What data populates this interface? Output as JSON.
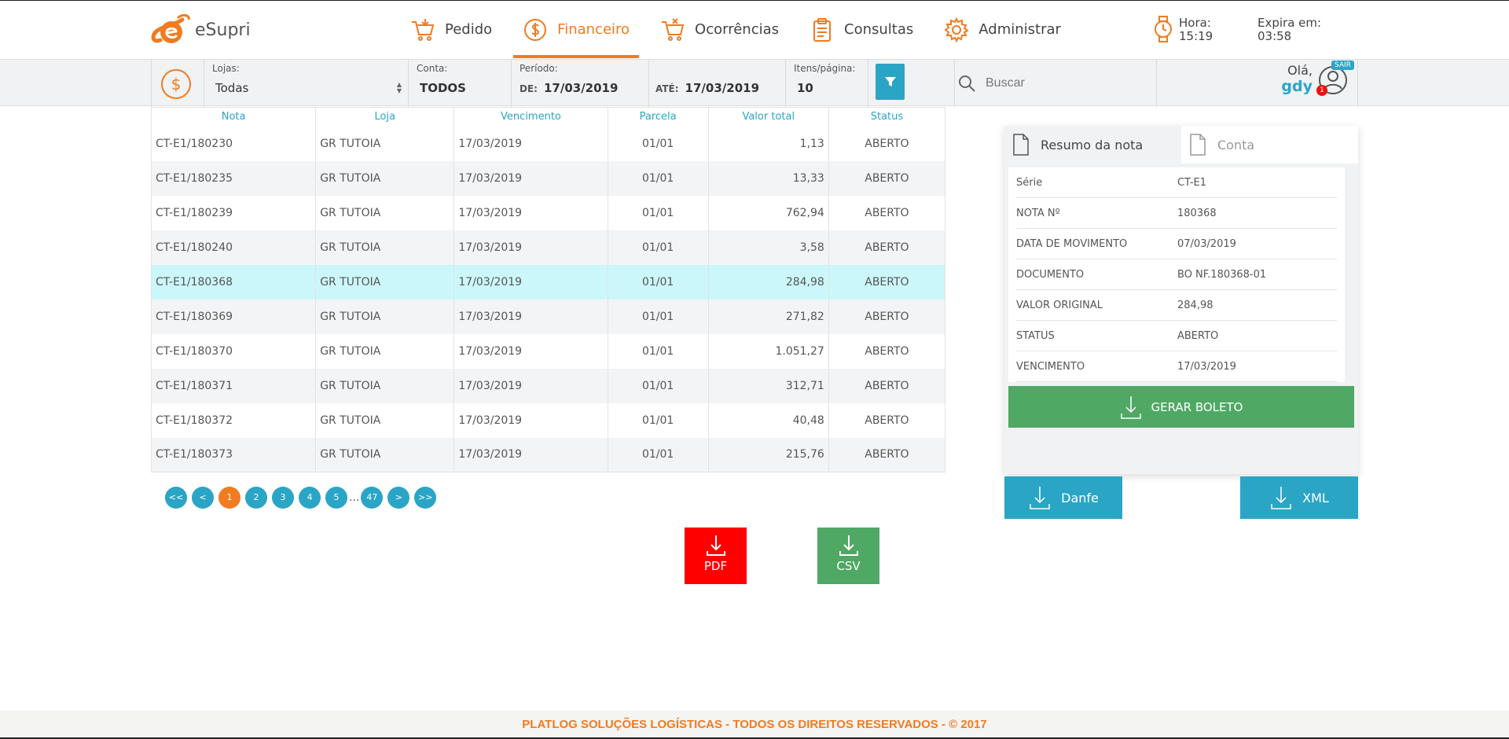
{
  "brand": {
    "name": "eSupri",
    "accent": "#f07b20",
    "secondary": "#2aa5c6"
  },
  "nav": [
    {
      "label": "Pedido",
      "icon": "cart-icon",
      "active": false
    },
    {
      "label": "Financeiro",
      "icon": "dollar-icon",
      "active": true
    },
    {
      "label": "Ocorrências",
      "icon": "cart-x-icon",
      "active": false
    },
    {
      "label": "Consultas",
      "icon": "clipboard-icon",
      "active": false
    },
    {
      "label": "Administrar",
      "icon": "gear-icon",
      "active": false
    }
  ],
  "session": {
    "hora_label": "Hora:",
    "hora_value": "15:19",
    "expira_label": "Expira em:",
    "expira_value": "03:58"
  },
  "filters": {
    "lojas_label": "Lojas:",
    "lojas_value": "Todas",
    "conta_label": "Conta:",
    "conta_value": "TODOS",
    "periodo_label": "Período:",
    "de_label": "DE:",
    "de_value": "17/03/2019",
    "ate_label": "ATÉ:",
    "ate_value": "17/03/2019",
    "itens_label": "Itens/página:",
    "itens_value": "10",
    "search_placeholder": "Buscar"
  },
  "user": {
    "greeting": "Olá,",
    "name": "gdy",
    "logout_label": "SAIR",
    "notifications": "1"
  },
  "table": {
    "headers": [
      "Nota",
      "Loja",
      "Vencimento",
      "Parcela",
      "Valor total",
      "Status"
    ],
    "rows": [
      [
        "CT-E1/180230",
        "GR TUTOIA",
        "17/03/2019",
        "01/01",
        "1,13",
        "ABERTO"
      ],
      [
        "CT-E1/180235",
        "GR TUTOIA",
        "17/03/2019",
        "01/01",
        "13,33",
        "ABERTO"
      ],
      [
        "CT-E1/180239",
        "GR TUTOIA",
        "17/03/2019",
        "01/01",
        "762,94",
        "ABERTO"
      ],
      [
        "CT-E1/180240",
        "GR TUTOIA",
        "17/03/2019",
        "01/01",
        "3,58",
        "ABERTO"
      ],
      [
        "CT-E1/180368",
        "GR TUTOIA",
        "17/03/2019",
        "01/01",
        "284,98",
        "ABERTO"
      ],
      [
        "CT-E1/180369",
        "GR TUTOIA",
        "17/03/2019",
        "01/01",
        "271,82",
        "ABERTO"
      ],
      [
        "CT-E1/180370",
        "GR TUTOIA",
        "17/03/2019",
        "01/01",
        "1.051,27",
        "ABERTO"
      ],
      [
        "CT-E1/180371",
        "GR TUTOIA",
        "17/03/2019",
        "01/01",
        "312,71",
        "ABERTO"
      ],
      [
        "CT-E1/180372",
        "GR TUTOIA",
        "17/03/2019",
        "01/01",
        "40,48",
        "ABERTO"
      ],
      [
        "CT-E1/180373",
        "GR TUTOIA",
        "17/03/2019",
        "01/01",
        "215,76",
        "ABERTO"
      ]
    ],
    "selected_row": 4
  },
  "pagination": {
    "first": "<<",
    "prev": "<",
    "pages": [
      "1",
      "2",
      "3",
      "4",
      "5"
    ],
    "active_page": "1",
    "ellipsis": "...",
    "last_page": "47",
    "next": ">",
    "last": ">>"
  },
  "export": {
    "pdf_label": "PDF",
    "csv_label": "CSV"
  },
  "panel": {
    "tab_resumo": "Resumo da nota",
    "tab_conta": "Conta",
    "details": [
      {
        "key": "Série",
        "value": "CT-E1"
      },
      {
        "key": "NOTA Nº",
        "value": "180368"
      },
      {
        "key": "DATA DE MOVIMENTO",
        "value": "07/03/2019"
      },
      {
        "key": "DOCUMENTO",
        "value": "BO NF.180368-01"
      },
      {
        "key": "VALOR ORIGINAL",
        "value": "284,98"
      },
      {
        "key": "STATUS",
        "value": "ABERTO"
      },
      {
        "key": "VENCIMENTO",
        "value": "17/03/2019"
      }
    ],
    "gerar_label": "GERAR BOLETO",
    "danfe_label": "Danfe",
    "xml_label": "XML"
  },
  "footer": {
    "text": "PLATLOG SOLUÇÕES LOGÍSTICAS - TODOS OS DIREITOS RESERVADOS - © 2017"
  }
}
